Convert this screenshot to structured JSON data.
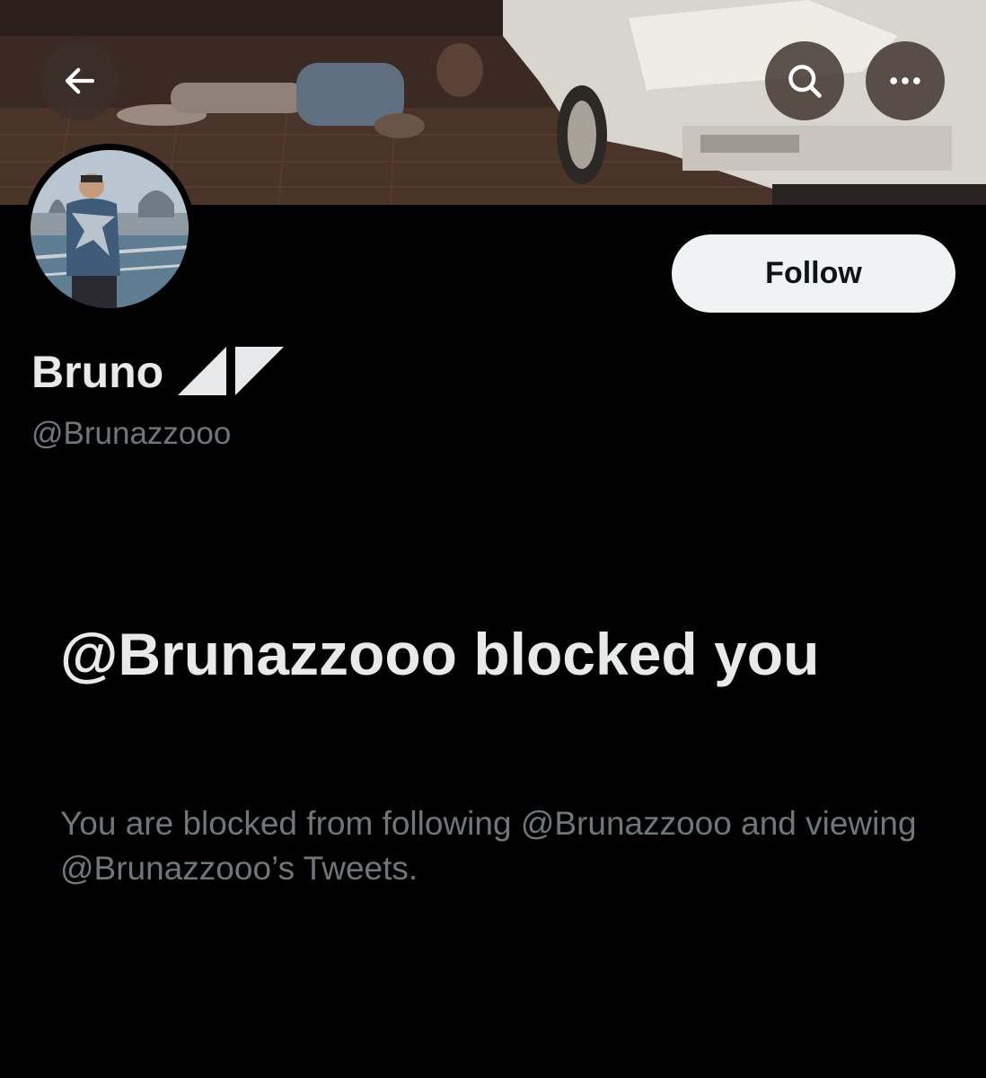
{
  "header": {
    "back_icon": "arrow-left-icon",
    "search_icon": "search-icon",
    "more_icon": "more-horizontal-icon"
  },
  "profile": {
    "display_name": "Bruno",
    "handle": "@Brunazzooo",
    "follow_label": "Follow"
  },
  "blocked": {
    "title": "@Brunazzooo blocked you",
    "description": "You are blocked from following @Brunazzooo and viewing @Brunazzooo’s Tweets."
  },
  "colors": {
    "background": "#000000",
    "primary_text": "#e7e9ea",
    "secondary_text": "#71767b",
    "follow_button_bg": "#eff3f4",
    "follow_button_text": "#0f1419"
  }
}
